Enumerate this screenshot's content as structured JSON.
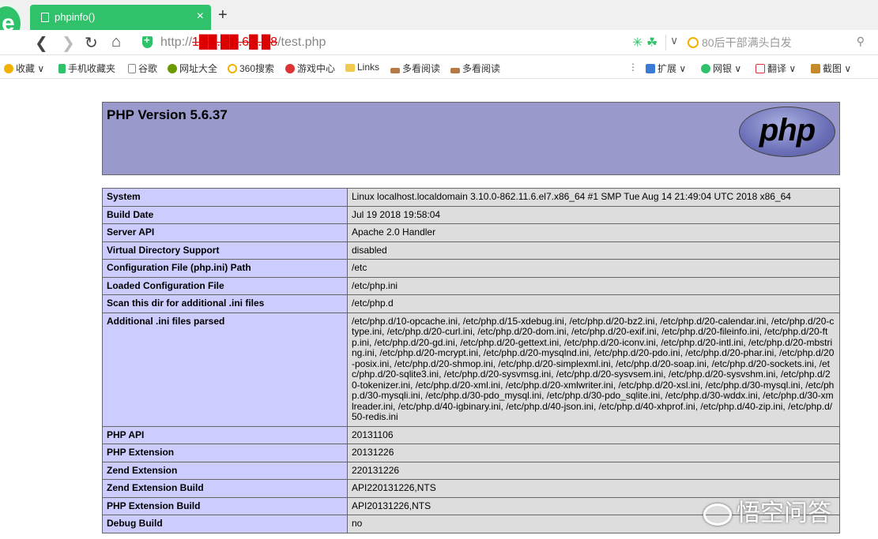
{
  "browser": {
    "tab_title": "phpinfo()",
    "tab_close": "×",
    "new_tab": "+",
    "url_scheme": "http://",
    "url_host": "1██.██.6█.█8",
    "url_path": "/test.php",
    "search_placeholder": "80后干部满头白发",
    "accent_color": "#2fc26a"
  },
  "bookmarks": [
    {
      "label": "收藏",
      "icon": "star-icon",
      "color": "#f2b100"
    },
    {
      "label": "手机收藏夹",
      "icon": "phone-icon",
      "color": "#2fc26a"
    },
    {
      "label": "谷歌",
      "icon": "page-icon",
      "color": "#888888"
    },
    {
      "label": "网址大全",
      "icon": "globe-icon",
      "color": "#6a9a00"
    },
    {
      "label": "360搜索",
      "icon": "search-icon",
      "color": "#f2b100"
    },
    {
      "label": "游戏中心",
      "icon": "game-icon",
      "color": "#d33"
    },
    {
      "label": "Links",
      "icon": "folder-icon",
      "color": "#f2c94c"
    },
    {
      "label": "多看阅读",
      "icon": "book-icon",
      "color": "#b57a45"
    },
    {
      "label": "多看阅读",
      "icon": "book-icon",
      "color": "#b57a45"
    },
    {
      "label": "扩展",
      "icon": "extension-icon",
      "color": "#3a7bd5"
    },
    {
      "label": "网银",
      "icon": "bank-icon",
      "color": "#2fc26a"
    },
    {
      "label": "翻译",
      "icon": "translate-icon",
      "color": "#d33"
    },
    {
      "label": "截图",
      "icon": "screenshot-icon",
      "color": "#c58a2a"
    }
  ],
  "php": {
    "version_title": "PHP Version 5.6.37",
    "logo_text": "php",
    "rows": [
      {
        "key": "System",
        "value": "Linux localhost.localdomain 3.10.0-862.11.6.el7.x86_64 #1 SMP Tue Aug 14 21:49:04 UTC 2018 x86_64"
      },
      {
        "key": "Build Date",
        "value": "Jul 19 2018 19:58:04"
      },
      {
        "key": "Server API",
        "value": "Apache 2.0 Handler"
      },
      {
        "key": "Virtual Directory Support",
        "value": "disabled"
      },
      {
        "key": "Configuration File (php.ini) Path",
        "value": "/etc"
      },
      {
        "key": "Loaded Configuration File",
        "value": "/etc/php.ini"
      },
      {
        "key": "Scan this dir for additional .ini files",
        "value": "/etc/php.d"
      },
      {
        "key": "Additional .ini files parsed",
        "value": "/etc/php.d/10-opcache.ini, /etc/php.d/15-xdebug.ini, /etc/php.d/20-bz2.ini, /etc/php.d/20-calendar.ini, /etc/php.d/20-ctype.ini, /etc/php.d/20-curl.ini, /etc/php.d/20-dom.ini, /etc/php.d/20-exif.ini, /etc/php.d/20-fileinfo.ini, /etc/php.d/20-ftp.ini, /etc/php.d/20-gd.ini, /etc/php.d/20-gettext.ini, /etc/php.d/20-iconv.ini, /etc/php.d/20-intl.ini, /etc/php.d/20-mbstring.ini, /etc/php.d/20-mcrypt.ini, /etc/php.d/20-mysqlnd.ini, /etc/php.d/20-pdo.ini, /etc/php.d/20-phar.ini, /etc/php.d/20-posix.ini, /etc/php.d/20-shmop.ini, /etc/php.d/20-simplexml.ini, /etc/php.d/20-soap.ini, /etc/php.d/20-sockets.ini, /etc/php.d/20-sqlite3.ini, /etc/php.d/20-sysvmsg.ini, /etc/php.d/20-sysvsem.ini, /etc/php.d/20-sysvshm.ini, /etc/php.d/20-tokenizer.ini, /etc/php.d/20-xml.ini, /etc/php.d/20-xmlwriter.ini, /etc/php.d/20-xsl.ini, /etc/php.d/30-mysql.ini, /etc/php.d/30-mysqli.ini, /etc/php.d/30-pdo_mysql.ini, /etc/php.d/30-pdo_sqlite.ini, /etc/php.d/30-wddx.ini, /etc/php.d/30-xmlreader.ini, /etc/php.d/40-igbinary.ini, /etc/php.d/40-json.ini, /etc/php.d/40-xhprof.ini, /etc/php.d/40-zip.ini, /etc/php.d/50-redis.ini"
      },
      {
        "key": "PHP API",
        "value": "20131106"
      },
      {
        "key": "PHP Extension",
        "value": "20131226"
      },
      {
        "key": "Zend Extension",
        "value": "220131226"
      },
      {
        "key": "Zend Extension Build",
        "value": "API220131226,NTS"
      },
      {
        "key": "PHP Extension Build",
        "value": "API20131226,NTS"
      },
      {
        "key": "Debug Build",
        "value": "no"
      }
    ]
  },
  "watermark": "悟空问答"
}
